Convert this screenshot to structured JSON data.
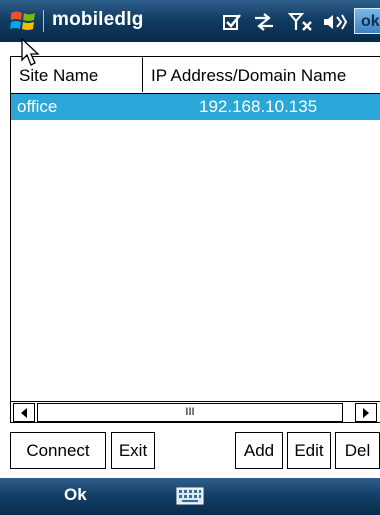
{
  "title_bar": {
    "app_title": "mobiledlg",
    "ok_label": "ok",
    "icons": [
      "windows-start-icon",
      "checkbox-icon",
      "connectivity-icon",
      "signal-off-icon",
      "volume-icon"
    ]
  },
  "list": {
    "columns": [
      "Site Name",
      "IP Address/Domain Name"
    ],
    "rows": [
      {
        "site_name": "office",
        "address": "192.168.10.135",
        "selected": true
      }
    ],
    "scroll_thumb_label": "III"
  },
  "buttons": {
    "connect": "Connect",
    "exit": "Exit",
    "add": "Add",
    "edit": "Edit",
    "del": "Del"
  },
  "softkeys": {
    "left": "Ok"
  },
  "colors": {
    "titlebar": "#123d63",
    "selection": "#2aa6d8"
  }
}
